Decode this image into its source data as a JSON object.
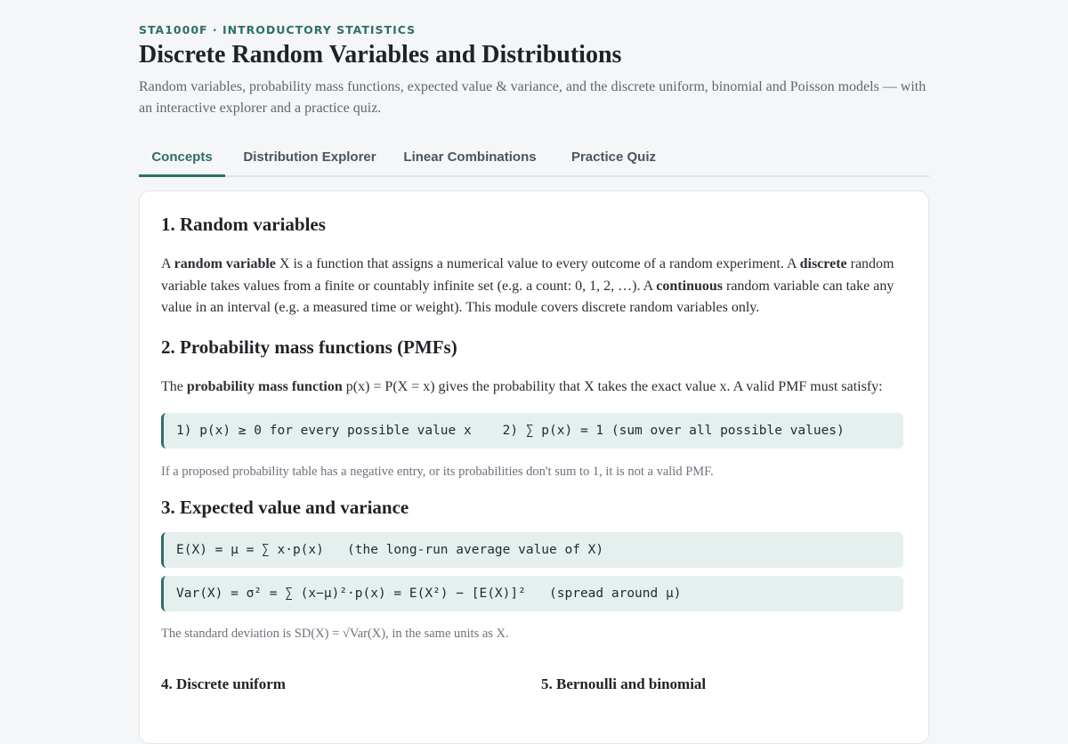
{
  "header": {
    "eyebrow": "STA1000F · INTRODUCTORY STATISTICS",
    "title": "Discrete Random Variables and Distributions",
    "subtitle": "Random variables, probability mass functions, expected value & variance, and the discrete uniform, binomial and Poisson models — with an interactive explorer and a practice quiz."
  },
  "tabs": [
    {
      "label": "Concepts",
      "active": true
    },
    {
      "label": "Distribution Explorer",
      "active": false
    },
    {
      "label": "Linear Combinations",
      "active": false
    },
    {
      "label": "Practice Quiz",
      "active": false
    }
  ],
  "sections": {
    "s1": {
      "heading": "1. Random variables",
      "p": [
        {
          "t": "A "
        },
        {
          "t": "random variable",
          "b": true
        },
        {
          "t": " X is a function that assigns a numerical value to every outcome of a random experiment. A "
        },
        {
          "t": "discrete",
          "b": true
        },
        {
          "t": " random variable takes values from a finite or countably infinite set (e.g. a count: 0, 1, 2, …). A "
        },
        {
          "t": "continuous",
          "b": true
        },
        {
          "t": " random variable can take any value in an interval (e.g. a measured time or weight). This module covers discrete random variables only."
        }
      ]
    },
    "s2": {
      "heading": "2. Probability mass functions (PMFs)",
      "p": [
        {
          "t": "The "
        },
        {
          "t": "probability mass function",
          "b": true
        },
        {
          "t": " p(x) = P(X = x) gives the probability that X takes the exact value x. A valid PMF must satisfy:"
        }
      ],
      "formula": "1) p(x) ≥ 0 for every possible value x    2) ∑ p(x) = 1 (sum over all possible values)",
      "note": "If a proposed probability table has a negative entry, or its probabilities don't sum to 1, it is not a valid PMF."
    },
    "s3": {
      "heading": "3. Expected value and variance",
      "formula1": "E(X) = μ = ∑ x·p(x)   (the long-run average value of X)",
      "formula2": "Var(X) = σ² = ∑ (x−μ)²·p(x) = E(X²) − [E(X)]²   (spread around μ)",
      "note": "The standard deviation is SD(X) = √Var(X), in the same units as X."
    },
    "s4": {
      "heading": "4. Discrete uniform"
    },
    "s5": {
      "heading": "5. Bernoulli and binomial"
    }
  },
  "colors": {
    "accent": "#2e6f6a",
    "formula_bg": "#e5f0ee",
    "page_bg": "#f5f6f7"
  }
}
